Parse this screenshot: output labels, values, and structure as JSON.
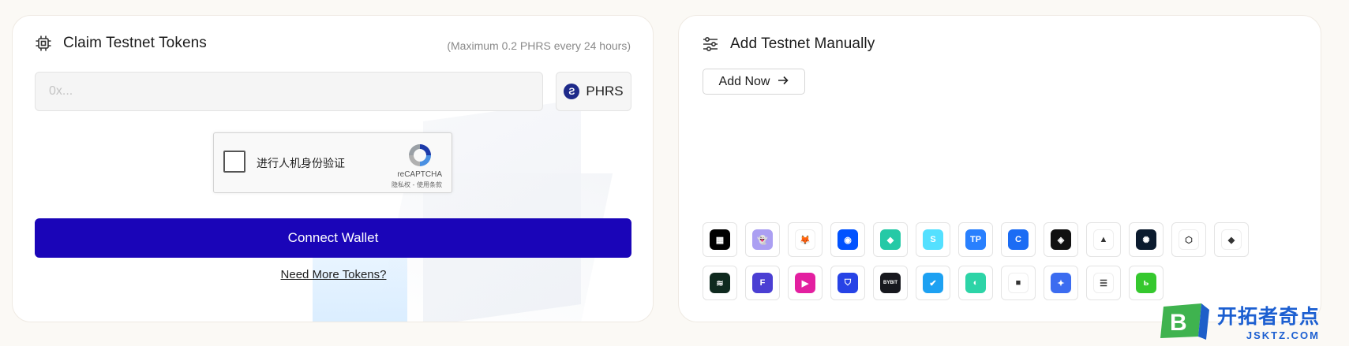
{
  "claim_card": {
    "title": "Claim Testnet Tokens",
    "limit_note": "(Maximum 0.2 PHRS every 24 hours)",
    "address_placeholder": "0x...",
    "token_symbol": "PHRS",
    "captcha": {
      "label": "进行人机身份验证",
      "brand": "reCAPTCHA",
      "terms": "隐私权 - 使用条款"
    },
    "connect_label": "Connect Wallet",
    "more_tokens_label": "Need More Tokens?"
  },
  "add_card": {
    "title": "Add Testnet Manually",
    "add_now_label": "Add Now",
    "wallets": [
      {
        "icon": "okx-wallet-icon",
        "bg": "#000000",
        "glyph": "▦"
      },
      {
        "icon": "phantom-wallet-icon",
        "bg": "#ab9ff2",
        "glyph": "👻"
      },
      {
        "icon": "metamask-wallet-icon",
        "bg": "#ffffff",
        "glyph": "🦊"
      },
      {
        "icon": "coinbase-wallet-icon",
        "bg": "#0052ff",
        "glyph": "◉"
      },
      {
        "icon": "bitget-wallet-icon",
        "bg": "#25c9a6",
        "glyph": "◆"
      },
      {
        "icon": "sui-wallet-icon",
        "bg": "#54e0ff",
        "glyph": "S"
      },
      {
        "icon": "tokenpocket-wallet-icon",
        "bg": "#2980fe",
        "glyph": "TP"
      },
      {
        "icon": "cake-wallet-icon",
        "bg": "#1b6cf4",
        "glyph": "C"
      },
      {
        "icon": "binance-wallet-icon",
        "bg": "#111111",
        "glyph": "◈"
      },
      {
        "icon": "rabby-wallet-icon",
        "bg": "#ffffff",
        "glyph": "▲"
      },
      {
        "icon": "onekey-wallet-icon",
        "bg": "#0b1b2e",
        "glyph": "✺"
      },
      {
        "icon": "rainbow-wallet-icon",
        "bg": "#ffffff",
        "glyph": "⬡"
      },
      {
        "icon": "trust-wallet-icon",
        "bg": "#ffffff",
        "glyph": "◆"
      },
      {
        "icon": "zerion-wallet-icon",
        "bg": "#0f2a1f",
        "glyph": "≋"
      },
      {
        "icon": "frontier-wallet-icon",
        "bg": "#4b3fd3",
        "glyph": "F"
      },
      {
        "icon": "xdefi-wallet-icon",
        "bg": "#e31fa0",
        "glyph": "▶"
      },
      {
        "icon": "safepal-wallet-icon",
        "bg": "#2743e6",
        "glyph": "⛉"
      },
      {
        "icon": "bybit-wallet-icon",
        "bg": "#17181e",
        "glyph": "BYBIT"
      },
      {
        "icon": "bitkeep-wallet-icon",
        "bg": "#1da1f2",
        "glyph": "✔"
      },
      {
        "icon": "imtoken-wallet-icon",
        "bg": "#2dd4a7",
        "glyph": "◐"
      },
      {
        "icon": "ledger-wallet-icon",
        "bg": "#ffffff",
        "glyph": "■"
      },
      {
        "icon": "gemini-wallet-icon",
        "bg": "#3c6cf0",
        "glyph": "✦"
      },
      {
        "icon": "coin98-wallet-icon",
        "bg": "#ffffff",
        "glyph": "☰"
      },
      {
        "icon": "gate-wallet-icon",
        "bg": "#35c82e",
        "glyph": "ь"
      }
    ]
  },
  "watermark": {
    "badge_letter": "B",
    "cn": "开拓者奇点",
    "en": "JSKTZ.COM"
  },
  "colors": {
    "connect_button": "#1a05b8",
    "page_bg": "#fbf9f5",
    "watermark_blue": "#1c5fd1"
  }
}
